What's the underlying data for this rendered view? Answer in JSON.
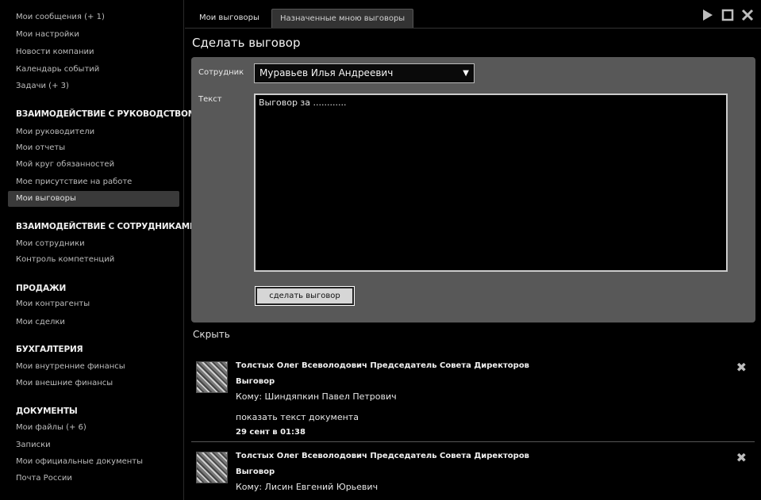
{
  "sidebar": {
    "items_top": [
      {
        "label": "Мои сообщения (+ 1)"
      },
      {
        "label": "Мои настройки"
      },
      {
        "label": "Новости компании"
      },
      {
        "label": "Календарь событий"
      },
      {
        "label": "Задачи (+ 3)"
      }
    ],
    "sections": [
      {
        "title": "ВЗАИМОДЕЙСТВИЕ С РУКОВОДСТВОМ",
        "items": [
          "Мои руководители",
          "Мои отчеты",
          "Мой круг обязанностей",
          "Мое присутствие на работе",
          "Мои выговоры"
        ]
      },
      {
        "title": "ВЗАИМОДЕЙСТВИЕ С СОТРУДНИКАМИ",
        "items": [
          "Мои сотрудники",
          "Контроль компетенций"
        ]
      },
      {
        "title": "ПРОДАЖИ",
        "items": [
          "Мои контрагенты",
          "Мои сделки"
        ]
      },
      {
        "title": "БУХГАЛТЕРИЯ",
        "items": [
          "Мои внутренние финансы",
          "Мои внешние финансы"
        ]
      },
      {
        "title": "ДОКУМЕНТЫ",
        "items": [
          "Мои файлы (+ 6)",
          "Записки",
          "Мои официальные документы",
          "Почта России"
        ]
      }
    ]
  },
  "tabs": [
    {
      "label": "Мои выговоры"
    },
    {
      "label": "Назначенные мною выговоры"
    }
  ],
  "form": {
    "title": "Сделать выговор",
    "employee_label": "Сотрудник",
    "employee_value": "Муравьев Илья Андреевич",
    "text_label": "Текст",
    "text_value": "Выговор за ............",
    "submit_label": "сделать выговор"
  },
  "hide_label": "Скрыть",
  "entries": [
    {
      "author": "Толстых Олег Всеволодович Председатель Совета Директоров",
      "type": "Выговор",
      "to": "Кому: Шиндяпкин Павел Петрович",
      "show": "показать текст документа",
      "date": "29 сент в 01:38"
    },
    {
      "author": "Толстых Олег Всеволодович Председатель Совета Директоров",
      "type": "Выговор",
      "to": "Кому: Лисин Евгений Юрьевич"
    }
  ],
  "icons": {
    "play": "play-icon",
    "maximize": "maximize-icon",
    "close": "close-icon",
    "delete": "delete-icon"
  }
}
